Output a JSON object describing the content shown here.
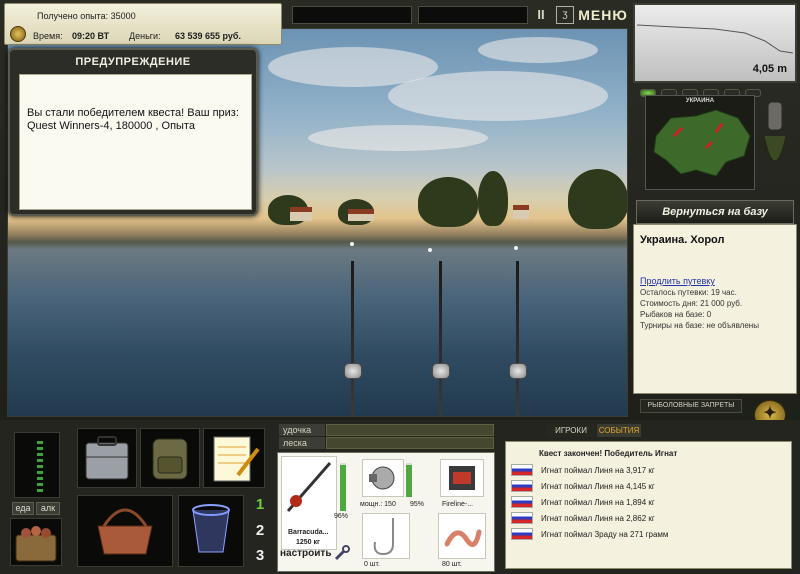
{
  "status": {
    "xp_text": "Получено опыта: 35000",
    "time_label": "Время:",
    "time_value": "09:20 ВТ",
    "money_label": "Деньги:",
    "money_value": "63 539 655 руб."
  },
  "topbar": {
    "pause_label": "II",
    "lang_label": "ʒ",
    "menu_label": "МЕНЮ"
  },
  "warning": {
    "title": "ПРЕДУПРЕЖДЕНИЕ",
    "message": "Вы стали победителем квеста! Ваш приз: Quest Winners-4, 180000 , Опыта"
  },
  "depth": {
    "value": "4,05 m"
  },
  "map": {
    "title": "УКРАИНА"
  },
  "back_button": "Вернуться на базу",
  "location": {
    "name": "Украина. Хорол",
    "extend_link": "Продлить путевку",
    "lines": [
      "Осталось путевки: 19 час.",
      "Стоимость дня: 21 000 руб.",
      "Рыбаков на базе: 0",
      "Турниры на базе: не объявлены"
    ]
  },
  "bans_button": "РЫБОЛОВНЫЕ ЗАПРЕТЫ",
  "bottom": {
    "food_tab": "еда",
    "bait_tab": "алк",
    "slots": [
      "1",
      "2",
      "3"
    ],
    "rod_label": "удочка",
    "line_label": "леска",
    "players_tab": "ИГРОКИ",
    "events_tab": "СОБЫТИЯ",
    "rod_name": "Barracuda...",
    "rod_weight": "1250 кг",
    "rod_pct": "96%",
    "reel_power": "мощн.: 150",
    "reel_pct": "95%",
    "line_name": "Fireline-...",
    "hook_count": "0 шт.",
    "bait_count": "80 шт.",
    "setup_label": "настроить",
    "levels": {
      "rod": 0.96,
      "reel": 0.95
    }
  },
  "events": {
    "header": "Квест закончен! Победитель Игнат",
    "items": [
      "Игнат поймал Линя на 3,917 кг",
      "Игнат поймал Линя на 4,145 кг",
      "Игнат поймал Линя на 1,894 кг",
      "Игнат поймал Линя на 2,862 кг",
      "Игнат поймал Зраду на 271 грамм"
    ]
  },
  "colors": {
    "panel_bg": "#24251f",
    "accent_green": "#4ea83f",
    "events_tab": "#e6a52b"
  }
}
